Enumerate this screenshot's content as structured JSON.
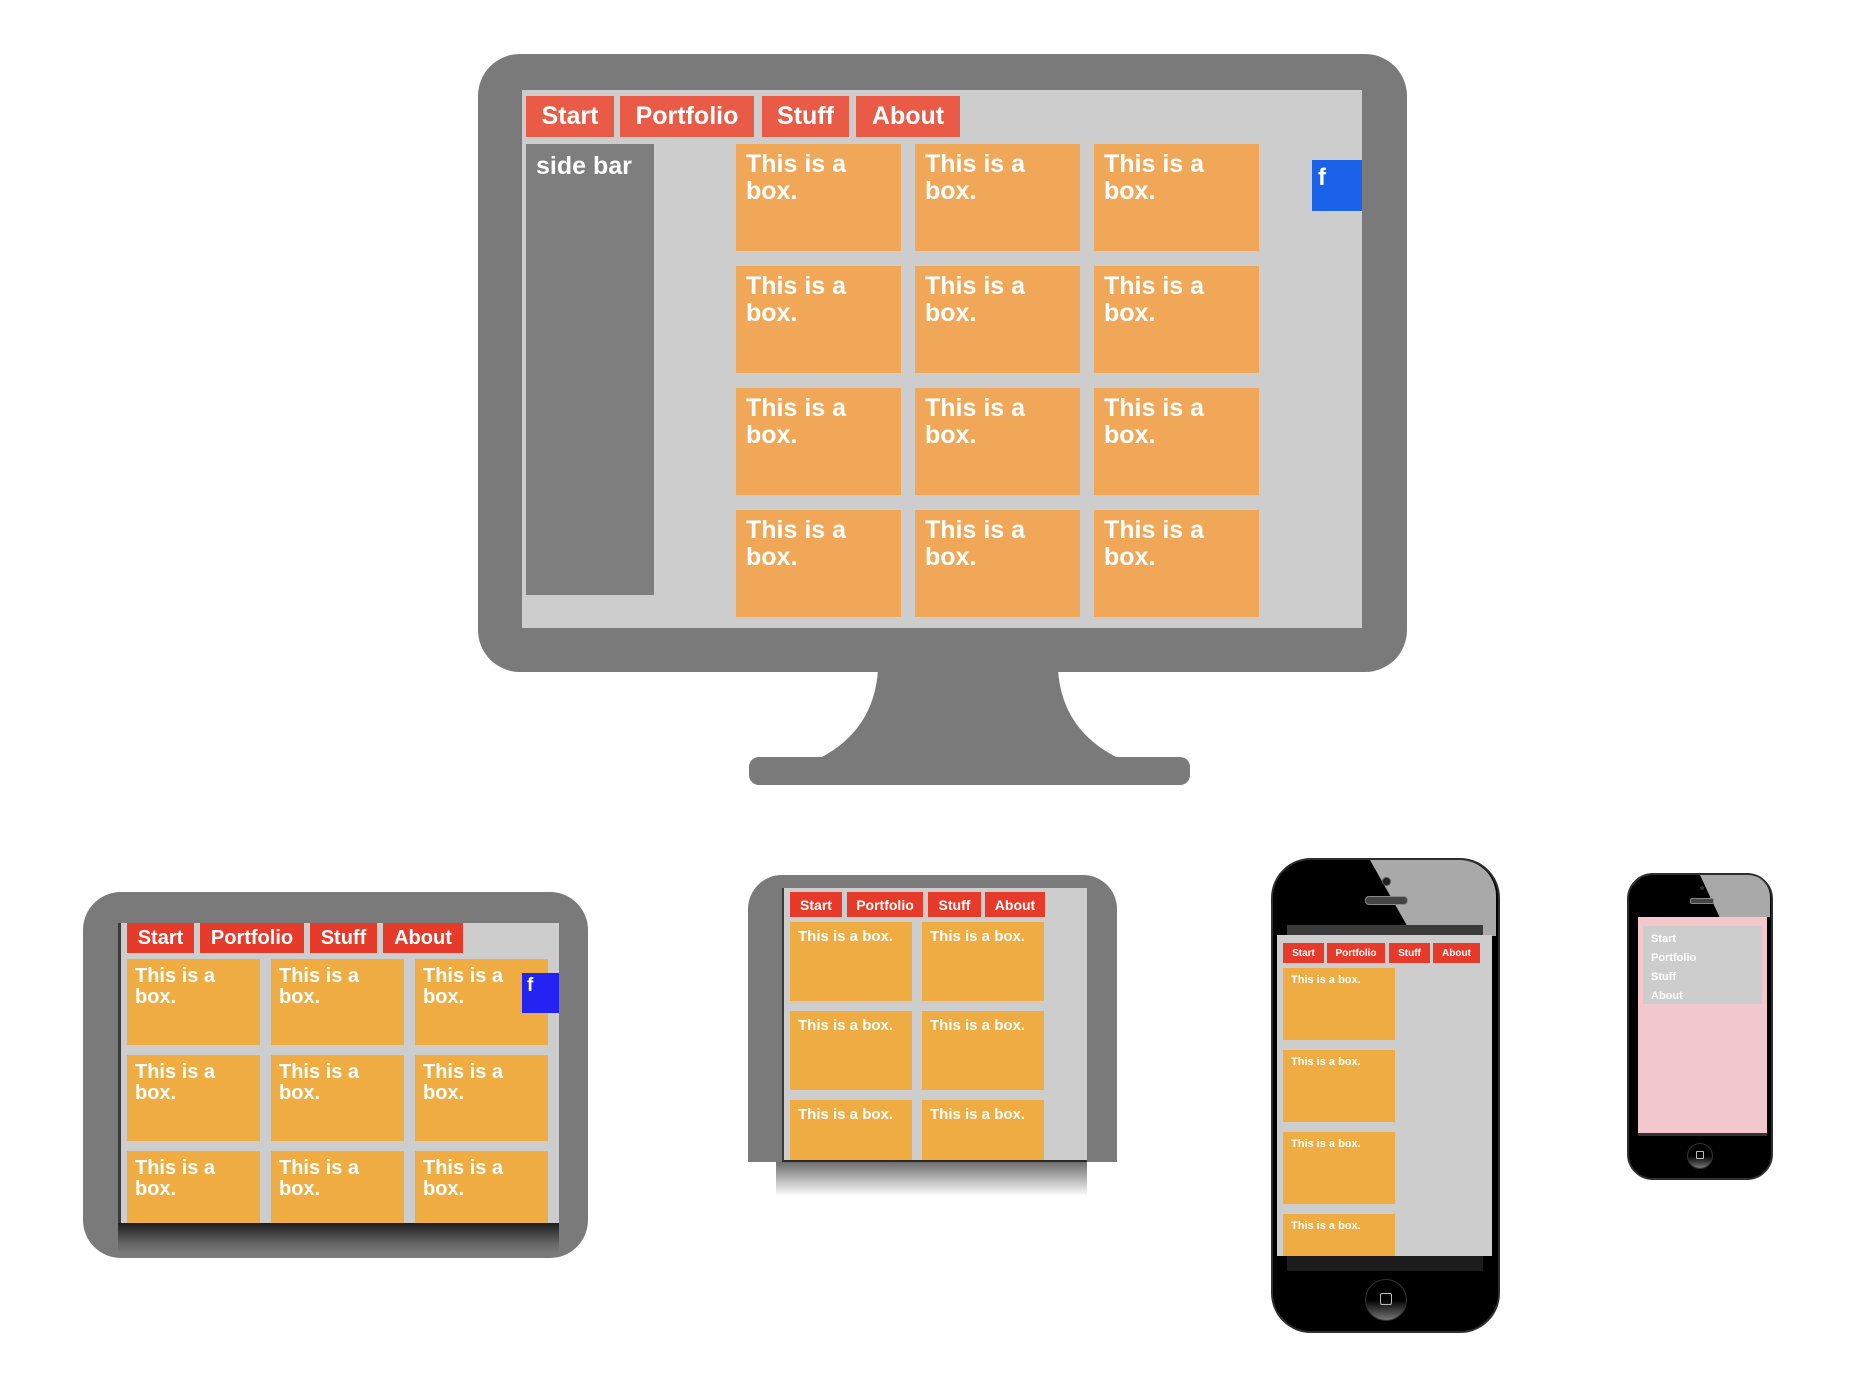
{
  "nav": {
    "items": [
      "Start",
      "Portfolio",
      "Stuff",
      "About"
    ]
  },
  "box_text": "This is a box.",
  "box_text_wrapped": [
    "This is a",
    "box."
  ],
  "facebook_label": "f",
  "devices": {
    "desktop": {
      "sidebar_label": "side bar",
      "grid": {
        "columns": 3,
        "rows": 4
      },
      "colors": {
        "nav": "#e95b47",
        "box": "#f0a858",
        "sidebar": "#7e7e7e",
        "facebook": "#1a62e8",
        "screen": "#cdcdcd",
        "frame": "#7a7a7a"
      }
    },
    "tablet_landscape": {
      "grid": {
        "columns": 3,
        "rows": 3
      },
      "colors": {
        "nav": "#e63b2a",
        "box": "#efac42",
        "facebook": "#2424f2"
      }
    },
    "tablet_portrait": {
      "grid": {
        "columns": 2,
        "rows": 3
      },
      "colors": {
        "nav": "#e63b2a",
        "box": "#efac42"
      }
    },
    "phone_large": {
      "grid": {
        "columns": 1,
        "rows": 4
      },
      "colors": {
        "nav": "#e63b2a",
        "box": "#efac42"
      }
    },
    "phone_small": {
      "menu_items": [
        "Start",
        "Portfolio",
        "Stuff",
        "About"
      ],
      "colors": {
        "background": "#f2c8cd",
        "menu": "#cdcdcd"
      }
    }
  }
}
